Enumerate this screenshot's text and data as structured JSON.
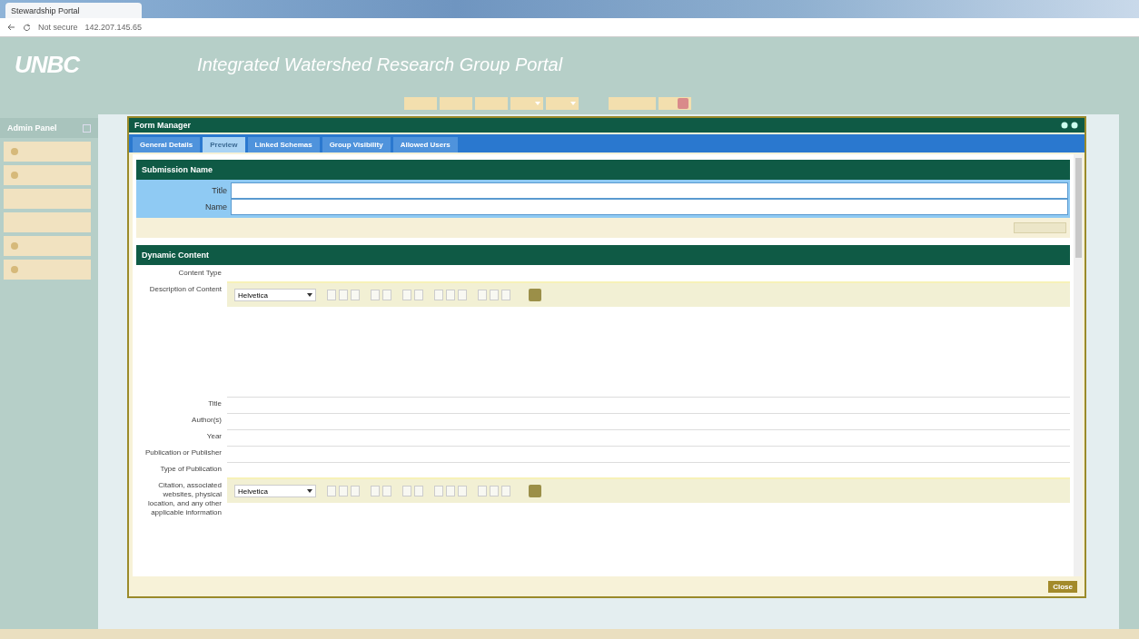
{
  "browser": {
    "tab_title": "Stewardship Portal",
    "security": "Not secure",
    "address": "142.207.145.65"
  },
  "header": {
    "logo": "UNBC",
    "title": "Integrated Watershed Research Group Portal",
    "nav": [
      {
        "kind": "button"
      },
      {
        "kind": "button"
      },
      {
        "kind": "button"
      },
      {
        "kind": "dropdown"
      },
      {
        "kind": "dropdown"
      },
      {
        "kind": "user"
      },
      {
        "kind": "alert"
      }
    ]
  },
  "sidebar": {
    "title": "Admin Panel",
    "items": [
      {
        "icon": true
      },
      {
        "icon": true
      },
      {
        "icon": false
      },
      {
        "icon": false
      },
      {
        "icon": true
      },
      {
        "icon": true
      }
    ]
  },
  "dialog": {
    "title": "Form Manager",
    "tabs": [
      {
        "label": "General Details",
        "selected": false
      },
      {
        "label": "Preview",
        "selected": true
      },
      {
        "label": "Linked Schemas",
        "selected": false
      },
      {
        "label": "Group Visibility",
        "selected": false
      },
      {
        "label": "Allowed Users",
        "selected": false
      }
    ],
    "submission": {
      "title": "Submission Name",
      "fields": [
        {
          "label": "Title"
        },
        {
          "label": "Name"
        }
      ]
    },
    "dynamic": {
      "title": "Dynamic Content",
      "rows": [
        {
          "kind": "text",
          "label": "Content Type"
        },
        {
          "kind": "editor",
          "label": "Description of Content",
          "font": "Helvetica"
        },
        {
          "kind": "input",
          "label": "Title"
        },
        {
          "kind": "input",
          "label": "Author(s)"
        },
        {
          "kind": "input",
          "label": "Year"
        },
        {
          "kind": "input",
          "label": "Publication or Publisher"
        },
        {
          "kind": "input",
          "label": "Type of Publication"
        },
        {
          "kind": "editor",
          "label": "Citation, associated websites, physical location, and any other applicable information",
          "font": "Helvetica"
        }
      ]
    },
    "close": "Close"
  }
}
